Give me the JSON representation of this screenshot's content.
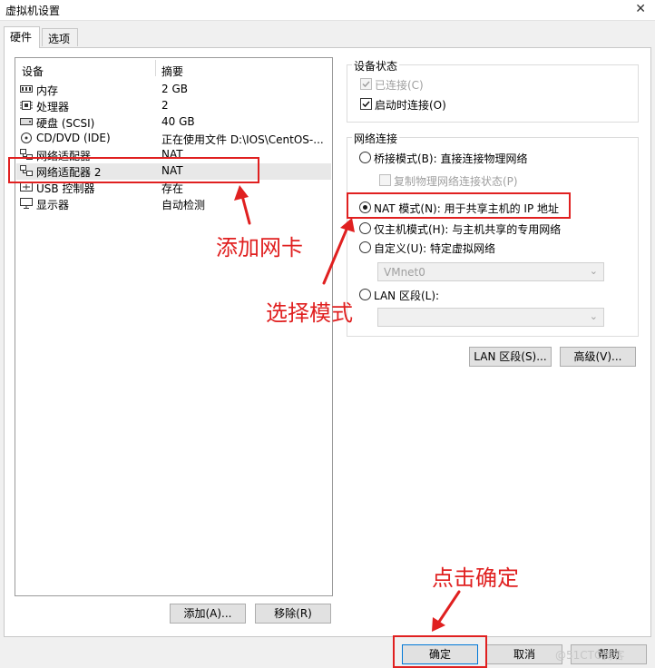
{
  "window": {
    "title": "虚拟机设置",
    "close_icon": "close-icon"
  },
  "tabs": [
    {
      "label": "硬件",
      "active": true
    },
    {
      "label": "选项",
      "active": false
    }
  ],
  "device_list": {
    "col_device": "设备",
    "col_summary": "摘要",
    "rows": [
      {
        "icon": "memory-icon",
        "name": "内存",
        "summary": "2 GB"
      },
      {
        "icon": "cpu-icon",
        "name": "处理器",
        "summary": "2"
      },
      {
        "icon": "hard-disk-icon",
        "name": "硬盘 (SCSI)",
        "summary": "40 GB"
      },
      {
        "icon": "cd-dvd-icon",
        "name": "CD/DVD (IDE)",
        "summary": "正在使用文件 D:\\IOS\\CentOS-..."
      },
      {
        "icon": "network-adapter-icon",
        "name": "网络适配器",
        "summary": "NAT"
      },
      {
        "icon": "network-adapter-icon",
        "name": "网络适配器 2",
        "summary": "NAT"
      },
      {
        "icon": "usb-icon",
        "name": "USB 控制器",
        "summary": "存在"
      },
      {
        "icon": "display-icon",
        "name": "显示器",
        "summary": "自动检测"
      }
    ],
    "add_button": "添加(A)...",
    "remove_button": "移除(R)"
  },
  "device_status": {
    "title": "设备状态",
    "connected_label": "已连接(C)",
    "connected_checked": true,
    "connect_at_poweron_label": "启动时连接(O)",
    "connect_at_poweron_checked": true
  },
  "network_connection": {
    "title": "网络连接",
    "bridged_label": "桥接模式(B): 直接连接物理网络",
    "replicate_label": "复制物理网络连接状态(P)",
    "nat_label": "NAT 模式(N): 用于共享主机的 IP 地址",
    "hostonly_label": "仅主机模式(H): 与主机共享的专用网络",
    "custom_label": "自定义(U): 特定虚拟网络",
    "custom_value": "VMnet0",
    "lan_label": "LAN 区段(L):",
    "lan_value": "",
    "selected": "nat"
  },
  "buttons": {
    "lan_segments": "LAN 区段(S)...",
    "advanced": "高级(V)...",
    "ok": "确定",
    "cancel": "取消",
    "help": "帮助"
  },
  "annotations": {
    "add_nic": "添加网卡",
    "choose_mode": "选择模式",
    "click_ok": "点击确定",
    "color": "#e02020"
  },
  "watermark": "@51CTO博客"
}
